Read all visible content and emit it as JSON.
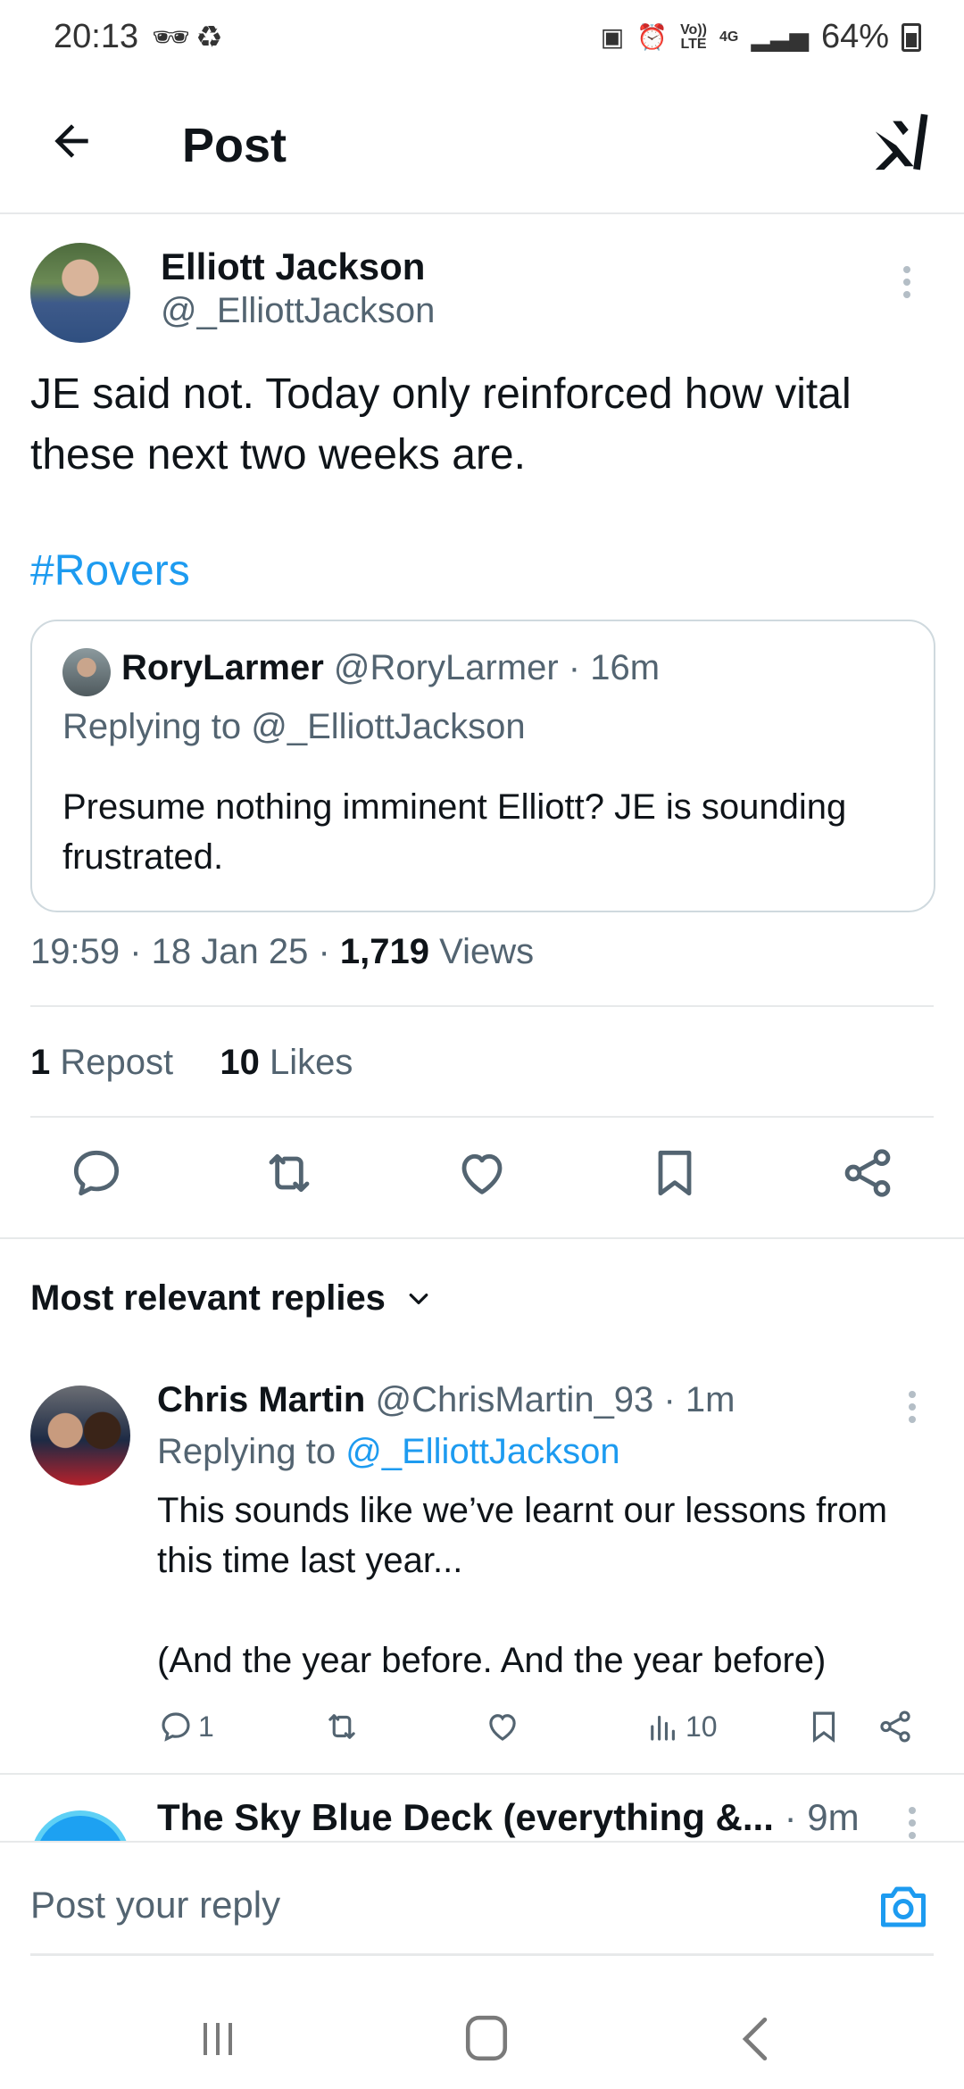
{
  "status_bar": {
    "time": "20:13",
    "lte_top": "Vo))",
    "lte_bottom": "LTE",
    "network": "4G",
    "battery": "64%"
  },
  "header": {
    "title": "Post",
    "back_icon": "arrow-left-icon",
    "logo_icon": "xai-logo"
  },
  "post": {
    "author_name": "Elliott Jackson",
    "author_handle": "@_ElliottJackson",
    "text": "JE said not. Today only reinforced how vital these next two weeks are.",
    "hashtag": "#Rovers",
    "quoted": {
      "name": "RoryLarmer",
      "handle": "@RoryLarmer",
      "time": "· 16m",
      "replying_to": "Replying to @_ElliottJackson",
      "text": "Presume nothing imminent Elliott? JE is sounding frustrated."
    },
    "time": "19:59",
    "date": "18 Jan 25",
    "sep": " · ",
    "views_count": "1,719",
    "views_label": "Views",
    "reposts_count": "1",
    "reposts_label": "Repost",
    "likes_count": "10",
    "likes_label": "Likes"
  },
  "actions": [
    "reply-icon",
    "repost-icon",
    "like-icon",
    "bookmark-icon",
    "share-icon"
  ],
  "replies_heading": "Most relevant replies",
  "replies": [
    {
      "name": "Chris Martin",
      "handle": "@ChrisMartin_93",
      "time": "· 1m",
      "replying_prefix": "Replying to",
      "replying_handle": "@_ElliottJackson",
      "text": "This sounds like we’ve learnt our lessons from this time last year...\n\n(And the year before. And the year before)",
      "reply_count": "1",
      "view_count": "10"
    },
    {
      "name": "The Sky Blue Deck (everything &...",
      "time": "· 9m"
    }
  ],
  "composer": {
    "placeholder": "Post your reply"
  }
}
